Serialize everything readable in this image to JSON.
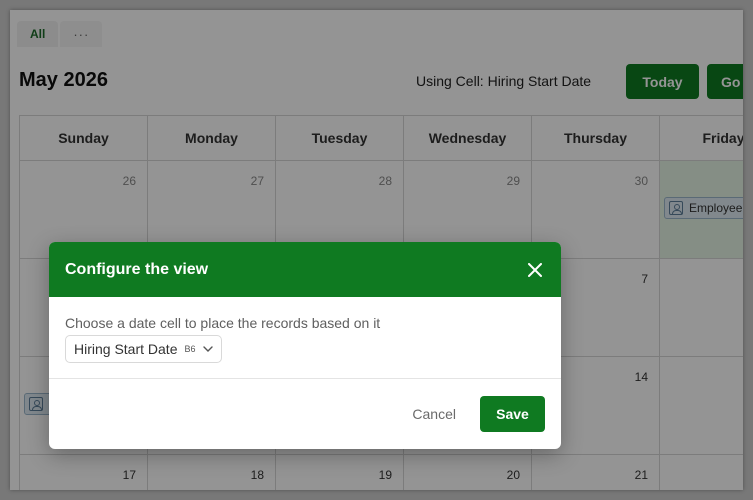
{
  "tabs": [
    {
      "label": "All"
    },
    {
      "label": "···"
    }
  ],
  "header": {
    "month": "May 2026",
    "using_cell": "Using Cell: Hiring Start Date",
    "today_label": "Today",
    "go_label": "Go"
  },
  "calendar": {
    "weekdays": [
      "Sunday",
      "Monday",
      "Tuesday",
      "Wednesday",
      "Thursday",
      "Friday"
    ],
    "week1": [
      "26",
      "27",
      "28",
      "29",
      "30",
      ""
    ],
    "week2": [
      "",
      "",
      "",
      "",
      "7",
      ""
    ],
    "week3": [
      "",
      "",
      "",
      "",
      "14",
      ""
    ],
    "week4": [
      "17",
      "18",
      "19",
      "20",
      "21",
      ""
    ],
    "event_label": "Employee"
  },
  "dialog": {
    "title": "Configure the view",
    "label": "Choose a date cell to place the records based on it",
    "select_value": "Hiring Start Date",
    "select_ref": "B6",
    "cancel_label": "Cancel",
    "save_label": "Save"
  },
  "colors": {
    "accent": "#0f7a21",
    "today_bg": "#e6f4e6"
  }
}
